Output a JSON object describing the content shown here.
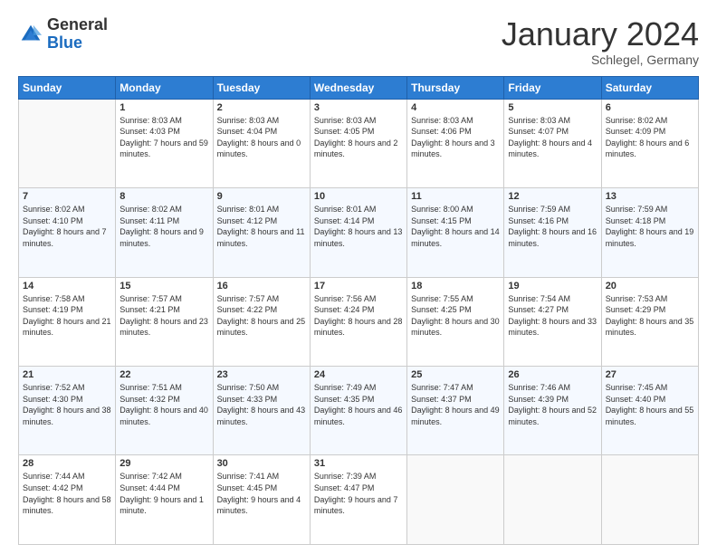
{
  "header": {
    "logo_general": "General",
    "logo_blue": "Blue",
    "month_title": "January 2024",
    "subtitle": "Schlegel, Germany"
  },
  "days_of_week": [
    "Sunday",
    "Monday",
    "Tuesday",
    "Wednesday",
    "Thursday",
    "Friday",
    "Saturday"
  ],
  "weeks": [
    [
      {
        "day": "",
        "sunrise": "",
        "sunset": "",
        "daylight": "",
        "empty": true
      },
      {
        "day": "1",
        "sunrise": "Sunrise: 8:03 AM",
        "sunset": "Sunset: 4:03 PM",
        "daylight": "Daylight: 7 hours and 59 minutes."
      },
      {
        "day": "2",
        "sunrise": "Sunrise: 8:03 AM",
        "sunset": "Sunset: 4:04 PM",
        "daylight": "Daylight: 8 hours and 0 minutes."
      },
      {
        "day": "3",
        "sunrise": "Sunrise: 8:03 AM",
        "sunset": "Sunset: 4:05 PM",
        "daylight": "Daylight: 8 hours and 2 minutes."
      },
      {
        "day": "4",
        "sunrise": "Sunrise: 8:03 AM",
        "sunset": "Sunset: 4:06 PM",
        "daylight": "Daylight: 8 hours and 3 minutes."
      },
      {
        "day": "5",
        "sunrise": "Sunrise: 8:03 AM",
        "sunset": "Sunset: 4:07 PM",
        "daylight": "Daylight: 8 hours and 4 minutes."
      },
      {
        "day": "6",
        "sunrise": "Sunrise: 8:02 AM",
        "sunset": "Sunset: 4:09 PM",
        "daylight": "Daylight: 8 hours and 6 minutes."
      }
    ],
    [
      {
        "day": "7",
        "sunrise": "Sunrise: 8:02 AM",
        "sunset": "Sunset: 4:10 PM",
        "daylight": "Daylight: 8 hours and 7 minutes."
      },
      {
        "day": "8",
        "sunrise": "Sunrise: 8:02 AM",
        "sunset": "Sunset: 4:11 PM",
        "daylight": "Daylight: 8 hours and 9 minutes."
      },
      {
        "day": "9",
        "sunrise": "Sunrise: 8:01 AM",
        "sunset": "Sunset: 4:12 PM",
        "daylight": "Daylight: 8 hours and 11 minutes."
      },
      {
        "day": "10",
        "sunrise": "Sunrise: 8:01 AM",
        "sunset": "Sunset: 4:14 PM",
        "daylight": "Daylight: 8 hours and 13 minutes."
      },
      {
        "day": "11",
        "sunrise": "Sunrise: 8:00 AM",
        "sunset": "Sunset: 4:15 PM",
        "daylight": "Daylight: 8 hours and 14 minutes."
      },
      {
        "day": "12",
        "sunrise": "Sunrise: 7:59 AM",
        "sunset": "Sunset: 4:16 PM",
        "daylight": "Daylight: 8 hours and 16 minutes."
      },
      {
        "day": "13",
        "sunrise": "Sunrise: 7:59 AM",
        "sunset": "Sunset: 4:18 PM",
        "daylight": "Daylight: 8 hours and 19 minutes."
      }
    ],
    [
      {
        "day": "14",
        "sunrise": "Sunrise: 7:58 AM",
        "sunset": "Sunset: 4:19 PM",
        "daylight": "Daylight: 8 hours and 21 minutes."
      },
      {
        "day": "15",
        "sunrise": "Sunrise: 7:57 AM",
        "sunset": "Sunset: 4:21 PM",
        "daylight": "Daylight: 8 hours and 23 minutes."
      },
      {
        "day": "16",
        "sunrise": "Sunrise: 7:57 AM",
        "sunset": "Sunset: 4:22 PM",
        "daylight": "Daylight: 8 hours and 25 minutes."
      },
      {
        "day": "17",
        "sunrise": "Sunrise: 7:56 AM",
        "sunset": "Sunset: 4:24 PM",
        "daylight": "Daylight: 8 hours and 28 minutes."
      },
      {
        "day": "18",
        "sunrise": "Sunrise: 7:55 AM",
        "sunset": "Sunset: 4:25 PM",
        "daylight": "Daylight: 8 hours and 30 minutes."
      },
      {
        "day": "19",
        "sunrise": "Sunrise: 7:54 AM",
        "sunset": "Sunset: 4:27 PM",
        "daylight": "Daylight: 8 hours and 33 minutes."
      },
      {
        "day": "20",
        "sunrise": "Sunrise: 7:53 AM",
        "sunset": "Sunset: 4:29 PM",
        "daylight": "Daylight: 8 hours and 35 minutes."
      }
    ],
    [
      {
        "day": "21",
        "sunrise": "Sunrise: 7:52 AM",
        "sunset": "Sunset: 4:30 PM",
        "daylight": "Daylight: 8 hours and 38 minutes."
      },
      {
        "day": "22",
        "sunrise": "Sunrise: 7:51 AM",
        "sunset": "Sunset: 4:32 PM",
        "daylight": "Daylight: 8 hours and 40 minutes."
      },
      {
        "day": "23",
        "sunrise": "Sunrise: 7:50 AM",
        "sunset": "Sunset: 4:33 PM",
        "daylight": "Daylight: 8 hours and 43 minutes."
      },
      {
        "day": "24",
        "sunrise": "Sunrise: 7:49 AM",
        "sunset": "Sunset: 4:35 PM",
        "daylight": "Daylight: 8 hours and 46 minutes."
      },
      {
        "day": "25",
        "sunrise": "Sunrise: 7:47 AM",
        "sunset": "Sunset: 4:37 PM",
        "daylight": "Daylight: 8 hours and 49 minutes."
      },
      {
        "day": "26",
        "sunrise": "Sunrise: 7:46 AM",
        "sunset": "Sunset: 4:39 PM",
        "daylight": "Daylight: 8 hours and 52 minutes."
      },
      {
        "day": "27",
        "sunrise": "Sunrise: 7:45 AM",
        "sunset": "Sunset: 4:40 PM",
        "daylight": "Daylight: 8 hours and 55 minutes."
      }
    ],
    [
      {
        "day": "28",
        "sunrise": "Sunrise: 7:44 AM",
        "sunset": "Sunset: 4:42 PM",
        "daylight": "Daylight: 8 hours and 58 minutes."
      },
      {
        "day": "29",
        "sunrise": "Sunrise: 7:42 AM",
        "sunset": "Sunset: 4:44 PM",
        "daylight": "Daylight: 9 hours and 1 minute."
      },
      {
        "day": "30",
        "sunrise": "Sunrise: 7:41 AM",
        "sunset": "Sunset: 4:45 PM",
        "daylight": "Daylight: 9 hours and 4 minutes."
      },
      {
        "day": "31",
        "sunrise": "Sunrise: 7:39 AM",
        "sunset": "Sunset: 4:47 PM",
        "daylight": "Daylight: 9 hours and 7 minutes."
      },
      {
        "day": "",
        "sunrise": "",
        "sunset": "",
        "daylight": "",
        "empty": true
      },
      {
        "day": "",
        "sunrise": "",
        "sunset": "",
        "daylight": "",
        "empty": true
      },
      {
        "day": "",
        "sunrise": "",
        "sunset": "",
        "daylight": "",
        "empty": true
      }
    ]
  ]
}
